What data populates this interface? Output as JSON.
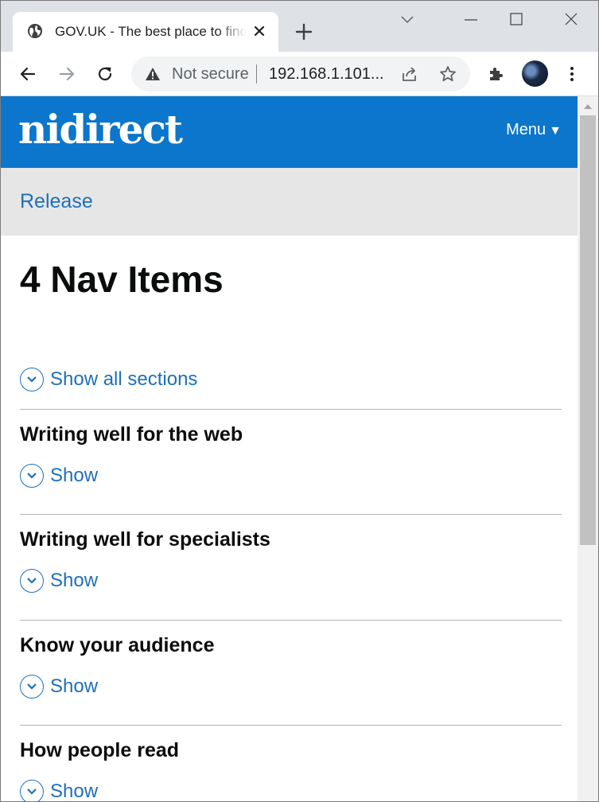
{
  "browser": {
    "tab_title": "GOV.UK - The best place to find government services and information",
    "omnibox": {
      "security_label": "Not secure",
      "url": "192.168.1.101..."
    }
  },
  "site": {
    "logo": "nidirect",
    "menu_label": "Menu",
    "menu_arrow": "▼",
    "breadcrumb": "Release",
    "page_title": "4 Nav Items",
    "show_all_label": "Show all sections",
    "sections": [
      {
        "title": "Writing well for the web",
        "toggle_label": "Show"
      },
      {
        "title": "Writing well for specialists",
        "toggle_label": "Show"
      },
      {
        "title": "Know your audience",
        "toggle_label": "Show"
      },
      {
        "title": "How people read",
        "toggle_label": "Show"
      }
    ]
  },
  "colors": {
    "header_blue": "#0b76cb",
    "link_blue": "#1d70b8",
    "breadcrumb_bar": "#e6e6e6",
    "text": "#0b0c0c"
  }
}
